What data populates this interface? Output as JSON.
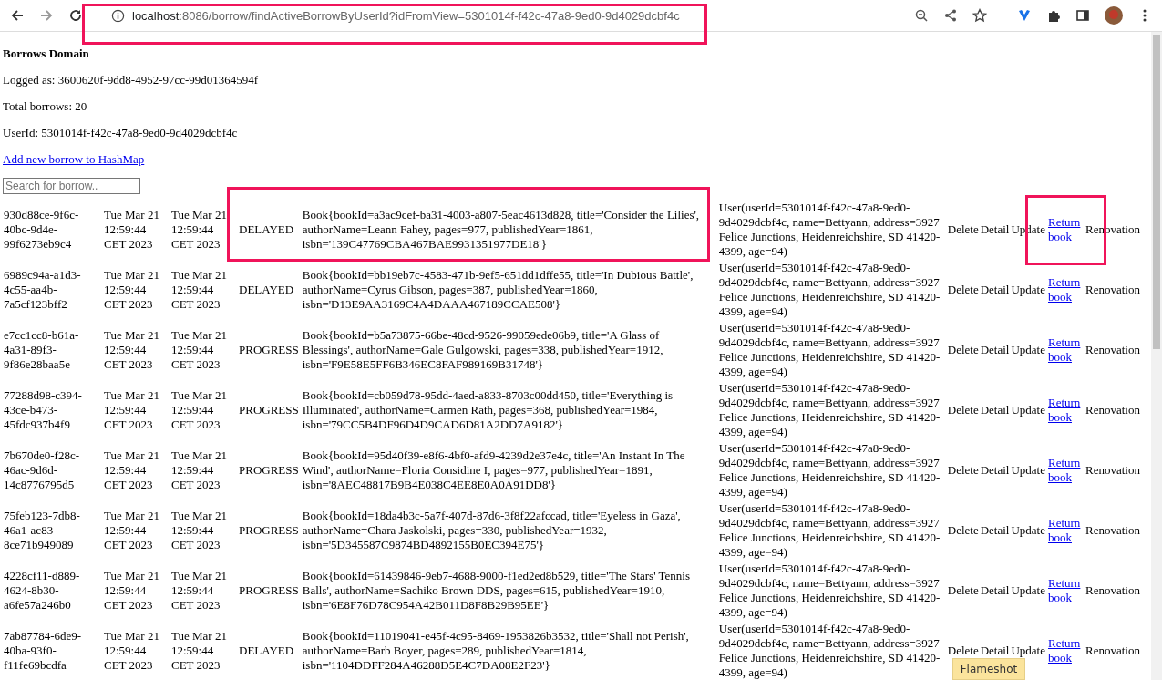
{
  "browser": {
    "url_host": "localhost",
    "url_rest": ":8086/borrow/findActiveBorrowByUserId?idFromView=5301014f-f42c-47a8-9ed0-9d4029dcbf4c"
  },
  "page": {
    "title": "Borrows Domain",
    "logged_as": "Logged as: 3600620f-9dd8-4952-97cc-99d01364594f",
    "total": "Total borrows: 20",
    "user_id": "UserId: 5301014f-f42c-47a8-9ed0-9d4029dcbf4c",
    "add_link": "Add new borrow to HashMap",
    "search": {
      "placeholder": "Search for borrow.."
    }
  },
  "table": {
    "rows": [
      {
        "id": "930d88ce-9f6c-40bc-9d4e-99f6273eb9c4",
        "start": "Tue Mar 21 12:59:44 CET 2023",
        "end": "Tue Mar 21 12:59:44 CET 2023",
        "status": "DELAYED",
        "book": "Book{bookId=a3ac9cef-ba31-4003-a807-5eac4613d828, title='Consider the Lilies', authorName=Leann Fahey, pages=977, publishedYear=1861, isbn='139C47769CBA467BAE9931351977DE18'}",
        "user": "User(userId=5301014f-f42c-47a8-9ed0-9d4029dcbf4c, name=Bettyann, address=3927 Felice Junctions, Heidenreichshire, SD 41420-4399, age=94)",
        "actions": [
          {
            "label": "Delete",
            "kind": "text"
          },
          {
            "label": "Detail",
            "kind": "text"
          },
          {
            "label": "Update",
            "kind": "text"
          },
          {
            "label": "Return book",
            "kind": "link"
          },
          {
            "label": "Renovation",
            "kind": "text"
          }
        ]
      },
      {
        "id": "6989c94a-a1d3-4c55-aa4b-7a5cf123bff2",
        "start": "Tue Mar 21 12:59:44 CET 2023",
        "end": "Tue Mar 21 12:59:44 CET 2023",
        "status": "DELAYED",
        "book": "Book{bookId=bb19eb7c-4583-471b-9ef5-651dd1dffe55, title='In Dubious Battle', authorName=Cyrus Gibson, pages=387, publishedYear=1860, isbn='D13E9AA3169C4A4DAAA467189CCAE508'}",
        "user": "User(userId=5301014f-f42c-47a8-9ed0-9d4029dcbf4c, name=Bettyann, address=3927 Felice Junctions, Heidenreichshire, SD 41420-4399, age=94)",
        "actions": [
          {
            "label": "Delete",
            "kind": "text"
          },
          {
            "label": "Detail",
            "kind": "text"
          },
          {
            "label": "Update",
            "kind": "text"
          },
          {
            "label": "Return book",
            "kind": "link"
          },
          {
            "label": "Renovation",
            "kind": "text"
          }
        ]
      },
      {
        "id": "e7cc1cc8-b61a-4a31-89f3-9f86e28baa5e",
        "start": "Tue Mar 21 12:59:44 CET 2023",
        "end": "Tue Mar 21 12:59:44 CET 2023",
        "status": "PROGRESS",
        "book": "Book{bookId=b5a73875-66be-48cd-9526-99059ede06b9, title='A Glass of Blessings', authorName=Gale Gulgowski, pages=338, publishedYear=1912, isbn='F9E58E5FF6B346EC8FAF989169B31748'}",
        "user": "User(userId=5301014f-f42c-47a8-9ed0-9d4029dcbf4c, name=Bettyann, address=3927 Felice Junctions, Heidenreichshire, SD 41420-4399, age=94)",
        "actions": [
          {
            "label": "Delete",
            "kind": "text"
          },
          {
            "label": "Detail",
            "kind": "text"
          },
          {
            "label": "Update",
            "kind": "text"
          },
          {
            "label": "Return book",
            "kind": "link"
          },
          {
            "label": "Renovation",
            "kind": "text"
          }
        ]
      },
      {
        "id": "77288d98-c394-43ce-b473-45fdc937b4f9",
        "start": "Tue Mar 21 12:59:44 CET 2023",
        "end": "Tue Mar 21 12:59:44 CET 2023",
        "status": "PROGRESS",
        "book": "Book{bookId=cb059d78-95dd-4aed-a833-8703c00dd450, title='Everything is Illuminated', authorName=Carmen Rath, pages=368, publishedYear=1984, isbn='79CC5B4DF96D4D9CAD6D81A2DD7A9182'}",
        "user": "User(userId=5301014f-f42c-47a8-9ed0-9d4029dcbf4c, name=Bettyann, address=3927 Felice Junctions, Heidenreichshire, SD 41420-4399, age=94)",
        "actions": [
          {
            "label": "Delete",
            "kind": "text"
          },
          {
            "label": "Detail",
            "kind": "text"
          },
          {
            "label": "Update",
            "kind": "text"
          },
          {
            "label": "Return book",
            "kind": "link"
          },
          {
            "label": "Renovation",
            "kind": "text"
          }
        ]
      },
      {
        "id": "7b670de0-f28c-46ac-9d6d-14c8776795d5",
        "start": "Tue Mar 21 12:59:44 CET 2023",
        "end": "Tue Mar 21 12:59:44 CET 2023",
        "status": "PROGRESS",
        "book": "Book{bookId=95d40f39-e8f6-4bf0-afd9-4239d2e37e4c, title='An Instant In The Wind', authorName=Floria Considine I, pages=977, publishedYear=1891, isbn='8AEC48817B9B4E038C4EE8E0A0A91DD8'}",
        "user": "User(userId=5301014f-f42c-47a8-9ed0-9d4029dcbf4c, name=Bettyann, address=3927 Felice Junctions, Heidenreichshire, SD 41420-4399, age=94)",
        "actions": [
          {
            "label": "Delete",
            "kind": "text"
          },
          {
            "label": "Detail",
            "kind": "text"
          },
          {
            "label": "Update",
            "kind": "text"
          },
          {
            "label": "Return book",
            "kind": "link"
          },
          {
            "label": "Renovation",
            "kind": "text"
          }
        ]
      },
      {
        "id": "75feb123-7db8-46a1-ac83-8ce71b949089",
        "start": "Tue Mar 21 12:59:44 CET 2023",
        "end": "Tue Mar 21 12:59:44 CET 2023",
        "status": "PROGRESS",
        "book": "Book{bookId=18da4b3c-5a7f-407d-87d6-3f8f22afccad, title='Eyeless in Gaza', authorName=Chara Jaskolski, pages=330, publishedYear=1932, isbn='5D345587C9874BD4892155B0EC394E75'}",
        "user": "User(userId=5301014f-f42c-47a8-9ed0-9d4029dcbf4c, name=Bettyann, address=3927 Felice Junctions, Heidenreichshire, SD 41420-4399, age=94)",
        "actions": [
          {
            "label": "Delete",
            "kind": "text"
          },
          {
            "label": "Detail",
            "kind": "text"
          },
          {
            "label": "Update",
            "kind": "text"
          },
          {
            "label": "Return book",
            "kind": "link"
          },
          {
            "label": "Renovation",
            "kind": "text"
          }
        ]
      },
      {
        "id": "4228cf11-d889-4624-8b30-a6fe57a246b0",
        "start": "Tue Mar 21 12:59:44 CET 2023",
        "end": "Tue Mar 21 12:59:44 CET 2023",
        "status": "PROGRESS",
        "book": "Book{bookId=61439846-9eb7-4688-9000-f1ed2ed8b529, title='The Stars' Tennis Balls', authorName=Sachiko Brown DDS, pages=615, publishedYear=1910, isbn='6E8F76D78C954A42B011D8F8B29B95EE'}",
        "user": "User(userId=5301014f-f42c-47a8-9ed0-9d4029dcbf4c, name=Bettyann, address=3927 Felice Junctions, Heidenreichshire, SD 41420-4399, age=94)",
        "actions": [
          {
            "label": "Delete",
            "kind": "text"
          },
          {
            "label": "Detail",
            "kind": "text"
          },
          {
            "label": "Update",
            "kind": "text"
          },
          {
            "label": "Return book",
            "kind": "link"
          },
          {
            "label": "Renovation",
            "kind": "text"
          }
        ]
      },
      {
        "id": "7ab87784-6de9-40ba-93f0-f11fe69bcdfa",
        "start": "Tue Mar 21 12:59:44 CET 2023",
        "end": "Tue Mar 21 12:59:44 CET 2023",
        "status": "DELAYED",
        "book": "Book{bookId=11019041-e45f-4c95-8469-1953826b3532, title='Shall not Perish', authorName=Barb Boyer, pages=289, publishedYear=1814, isbn='1104DDFF284A46288D5E4C7DA08E2F23'}",
        "user": "User(userId=5301014f-f42c-47a8-9ed0-9d4029dcbf4c, name=Bettyann, address=3927 Felice Junctions, Heidenreichshire, SD 41420-4399, age=94)",
        "actions": [
          {
            "label": "Delete",
            "kind": "text"
          },
          {
            "label": "Detail",
            "kind": "text"
          },
          {
            "label": "Update",
            "kind": "text"
          },
          {
            "label": "Return book",
            "kind": "link"
          },
          {
            "label": "Renovation",
            "kind": "text"
          }
        ]
      }
    ]
  },
  "tooltip": {
    "label": "Flameshot"
  }
}
